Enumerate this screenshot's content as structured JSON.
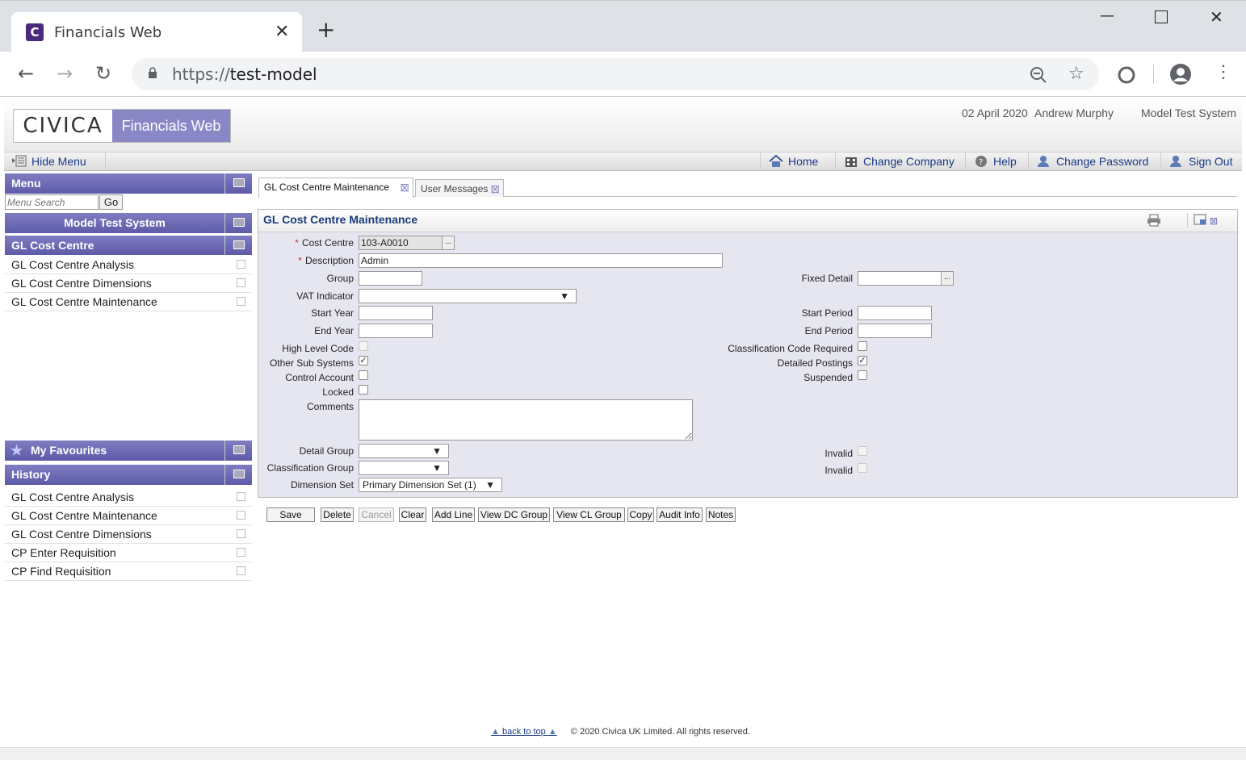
{
  "browser": {
    "tab_title": "Financials Web",
    "favicon_letter": "C",
    "url_scheme": "https://",
    "url_host": "test-model",
    "icons": [
      "back-icon",
      "forward-icon",
      "reload-icon",
      "lock-icon",
      "zoom-out-icon",
      "star-icon",
      "extension-icon",
      "profile-icon",
      "kebab-menu-icon"
    ]
  },
  "header": {
    "logo_civica": "CIVICA",
    "logo_product": "Financials Web",
    "date": "02 April 2020",
    "user": "Andrew Murphy",
    "system": "Model Test System"
  },
  "menubar": {
    "hide_menu": "Hide Menu",
    "home": "Home",
    "change_company": "Change Company",
    "help": "Help",
    "change_password": "Change Password",
    "sign_out": "Sign Out"
  },
  "sidebar": {
    "menu_title": "Menu",
    "search_placeholder": "Menu Search",
    "go": "Go",
    "system_title": "Model Test System",
    "section_title": "GL Cost Centre",
    "items": [
      {
        "label": "GL Cost Centre Analysis"
      },
      {
        "label": "GL Cost Centre Dimensions"
      },
      {
        "label": "GL Cost Centre Maintenance"
      }
    ],
    "favourites_title": "My Favourites",
    "history_title": "History",
    "history": [
      {
        "label": "GL Cost Centre Analysis"
      },
      {
        "label": "GL Cost Centre Maintenance"
      },
      {
        "label": "GL Cost Centre Dimensions"
      },
      {
        "label": "CP Enter Requisition"
      },
      {
        "label": "CP Find Requisition"
      }
    ]
  },
  "tabs": [
    {
      "label": "GL Cost Centre Maintenance"
    },
    {
      "label": "User Messages"
    }
  ],
  "form": {
    "title": "GL Cost Centre Maintenance",
    "cost_centre_label": "Cost Centre",
    "cost_centre_value": "103-A0010",
    "description_label": "Description",
    "description_value": "Admin",
    "group_label": "Group",
    "fixed_detail_label": "Fixed Detail",
    "vat_label": "VAT Indicator",
    "start_year_label": "Start Year",
    "start_period_label": "Start Period",
    "end_year_label": "End Year",
    "end_period_label": "End Period",
    "high_level_label": "High Level Code",
    "class_req_label": "Classification Code Required",
    "other_sub_label": "Other Sub Systems",
    "detailed_postings_label": "Detailed Postings",
    "control_account_label": "Control Account",
    "suspended_label": "Suspended",
    "locked_label": "Locked",
    "comments_label": "Comments",
    "detail_group_label": "Detail Group",
    "invalid_label": "Invalid",
    "classification_group_label": "Classification Group",
    "invalid2_label": "Invalid",
    "dimension_set_label": "Dimension Set",
    "dimension_set_value": "Primary Dimension Set (1)",
    "ellipsis": "...",
    "checked": {
      "other_sub_systems": true,
      "detailed_postings": true,
      "high_level_code": false,
      "classification_code_required": false,
      "control_account": false,
      "suspended": false,
      "locked": false
    }
  },
  "buttons": {
    "save": "Save",
    "delete": "Delete",
    "cancel": "Cancel",
    "clear": "Clear",
    "add_line": "Add Line",
    "view_dc_group": "View DC Group",
    "view_cl_group": "View CL Group",
    "copy": "Copy",
    "audit_info": "Audit Info",
    "notes": "Notes"
  },
  "footer": {
    "back_to_top": "back to top",
    "copyright": "© 2020 Civica UK Limited. All rights reserved."
  },
  "colors": {
    "accent": "#5d5aa8",
    "brand": "#8a87c7",
    "link": "#1a3a8a"
  }
}
